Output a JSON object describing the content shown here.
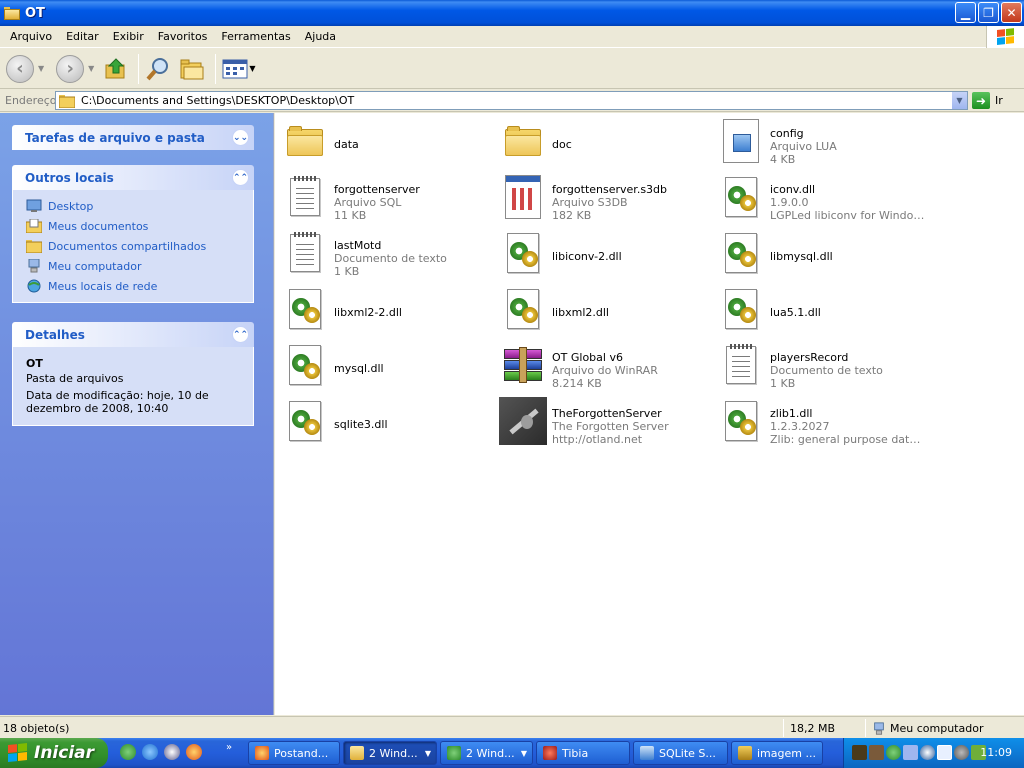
{
  "window": {
    "title": "OT"
  },
  "menu": [
    "Arquivo",
    "Editar",
    "Exibir",
    "Favoritos",
    "Ferramentas",
    "Ajuda"
  ],
  "address": {
    "label": "Endereço",
    "path": "C:\\Documents and Settings\\DESKTOP\\Desktop\\OT",
    "go_label": "Ir"
  },
  "panels": {
    "tasks": {
      "title": "Tarefas de arquivo e pasta"
    },
    "places": {
      "title": "Outros locais",
      "items": [
        "Desktop",
        "Meus documentos",
        "Documentos compartilhados",
        "Meu computador",
        "Meus locais de rede"
      ]
    },
    "details": {
      "title": "Detalhes",
      "name": "OT",
      "type": "Pasta de arquivos",
      "modified": "Data de modificação: hoje, 10 de dezembro de 2008, 10:40"
    }
  },
  "files": [
    {
      "name": "data",
      "line2": "",
      "line3": "",
      "icon": "folder-icon"
    },
    {
      "name": "doc",
      "line2": "",
      "line3": "",
      "icon": "folder-icon"
    },
    {
      "name": "config",
      "line2": "Arquivo LUA",
      "line3": "4 KB",
      "icon": "lua-file-icon"
    },
    {
      "name": "forgottenserver",
      "line2": "Arquivo SQL",
      "line3": "11 KB",
      "icon": "text-document-icon"
    },
    {
      "name": "forgottenserver.s3db",
      "line2": "Arquivo S3DB",
      "line3": "182 KB",
      "icon": "s3db-file-icon"
    },
    {
      "name": "iconv.dll",
      "line2": "1.9.0.0",
      "line3": "LGPLed libiconv for Windows N...",
      "icon": "dll-file-icon"
    },
    {
      "name": "lastMotd",
      "line2": "Documento de texto",
      "line3": "1 KB",
      "icon": "text-document-icon"
    },
    {
      "name": "libiconv-2.dll",
      "line2": "",
      "line3": "",
      "icon": "dll-file-icon"
    },
    {
      "name": "libmysql.dll",
      "line2": "",
      "line3": "",
      "icon": "dll-file-icon"
    },
    {
      "name": "libxml2-2.dll",
      "line2": "",
      "line3": "",
      "icon": "dll-file-icon"
    },
    {
      "name": "libxml2.dll",
      "line2": "",
      "line3": "",
      "icon": "dll-file-icon"
    },
    {
      "name": "lua5.1.dll",
      "line2": "",
      "line3": "",
      "icon": "dll-file-icon"
    },
    {
      "name": "mysql.dll",
      "line2": "",
      "line3": "",
      "icon": "dll-file-icon"
    },
    {
      "name": "OT Global v6",
      "line2": "Arquivo do WinRAR",
      "line3": "8.214 KB",
      "icon": "winrar-archive-icon"
    },
    {
      "name": "playersRecord",
      "line2": "Documento de texto",
      "line3": "1 KB",
      "icon": "text-document-icon"
    },
    {
      "name": "sqlite3.dll",
      "line2": "",
      "line3": "",
      "icon": "dll-file-icon"
    },
    {
      "name": "TheForgottenServer",
      "line2": "The Forgotten Server",
      "line3": "http://otland.net",
      "icon": "sword-app-icon"
    },
    {
      "name": "zlib1.dll",
      "line2": "1.2.3.2027",
      "line3": "Zlib: general purpose data co...",
      "icon": "dll-file-icon"
    }
  ],
  "status": {
    "count": "18 objeto(s)",
    "size": "18,2 MB",
    "location": "Meu computador"
  },
  "taskbar": {
    "start_label": "Iniciar",
    "tasks": [
      {
        "label": "Postand...",
        "active": false
      },
      {
        "label": "2 Wind...",
        "active": true
      },
      {
        "label": "2 Wind...",
        "active": false
      },
      {
        "label": "Tibia",
        "active": false
      },
      {
        "label": "SQLite S...",
        "active": false
      },
      {
        "label": "imagem ...",
        "active": false
      }
    ],
    "clock": "11:09"
  }
}
